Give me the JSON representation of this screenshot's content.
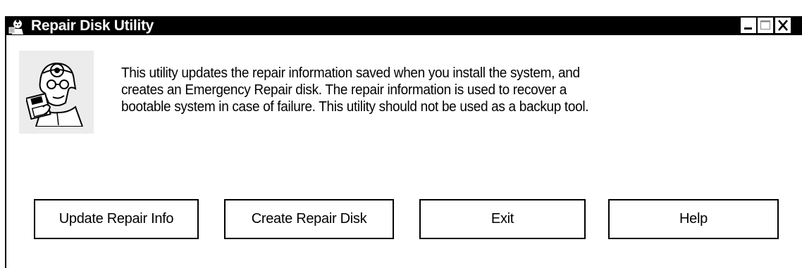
{
  "window": {
    "title": "Repair Disk Utility",
    "title_icon": "repair-doctor-icon",
    "controls": {
      "minimize_icon": "minimize-icon",
      "maximize_icon": "maximize-icon",
      "close_icon": "close-icon"
    }
  },
  "main": {
    "logo_icon": "doctor-with-disk-icon",
    "description_lines": [
      "This utility updates the repair information saved when you install the system, and",
      "creates an Emergency Repair disk. The repair information is used to recover a",
      "bootable system in case of failure. This utility should not be used as a backup tool."
    ]
  },
  "buttons": {
    "update": "Update Repair Info",
    "create": "Create Repair Disk",
    "exit": "Exit",
    "help": "Help"
  },
  "colors": {
    "titlebar_bg": "#000000",
    "titlebar_text": "#ffffff",
    "window_bg": "#ffffff",
    "logo_tile_bg": "#ececec"
  }
}
